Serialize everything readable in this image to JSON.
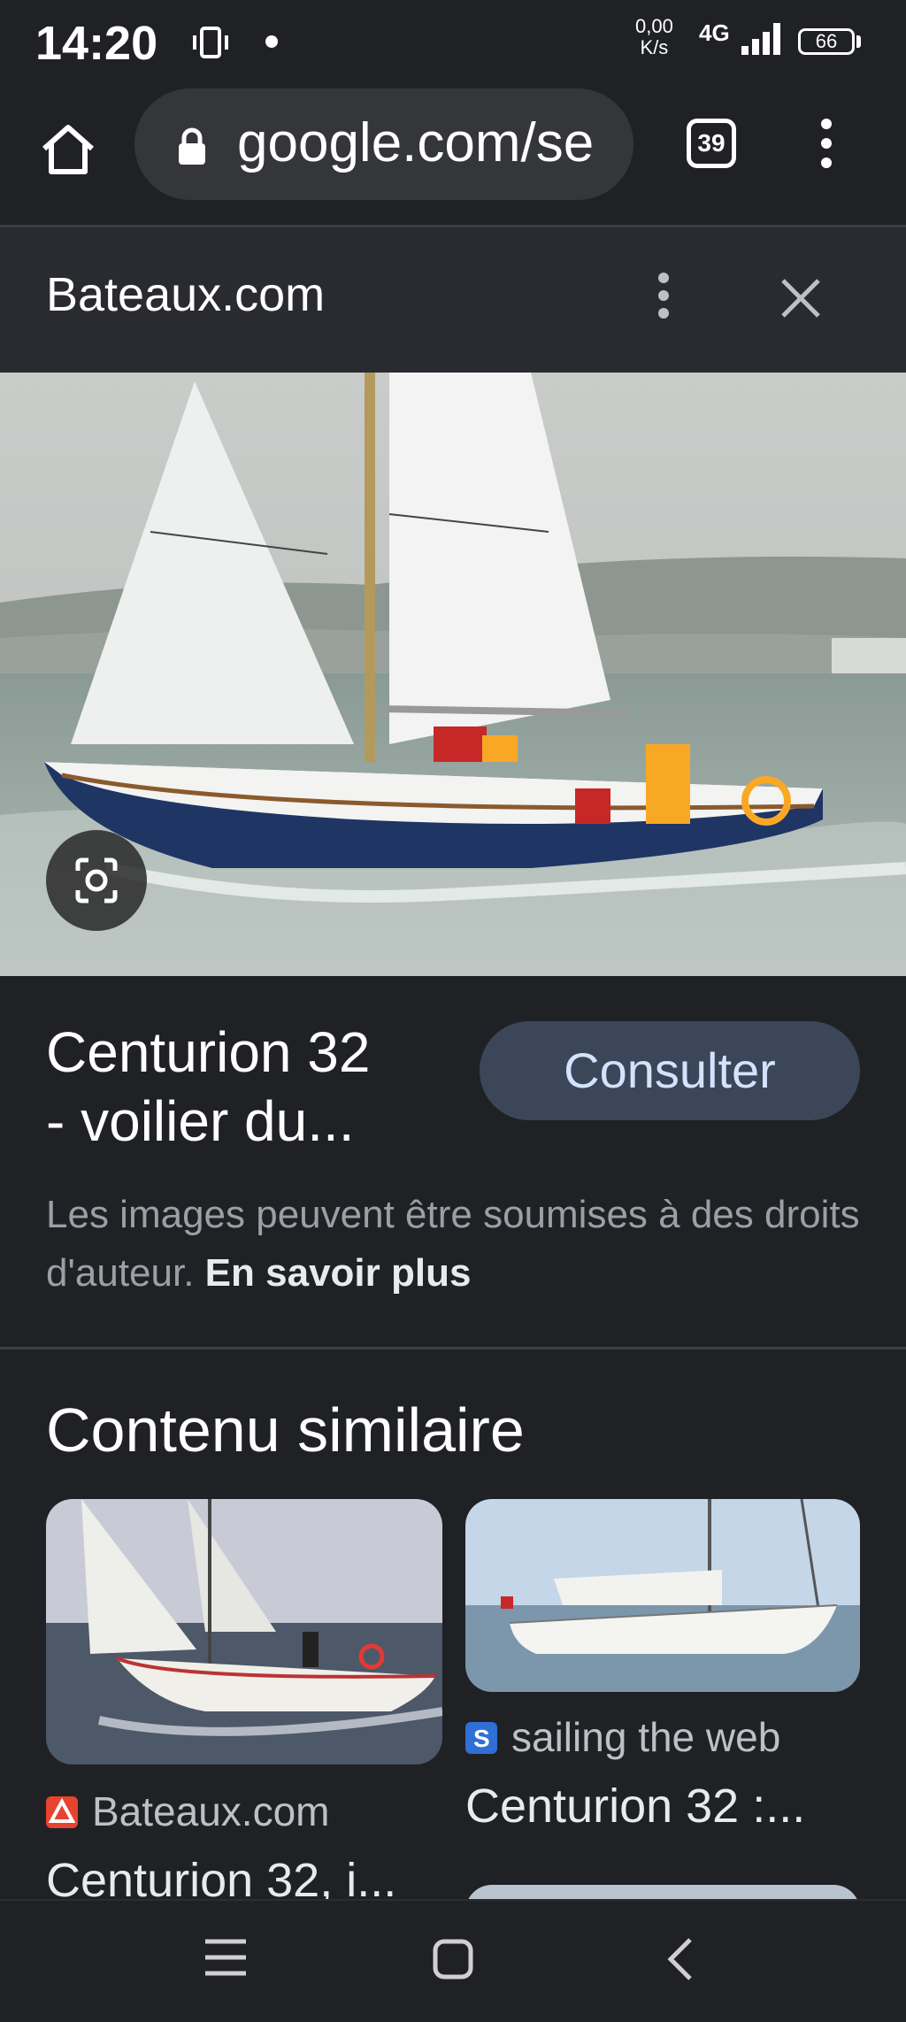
{
  "status_bar": {
    "time": "14:20",
    "speed_value": "0,00",
    "speed_unit": "K/s",
    "network": "4G",
    "battery": "66"
  },
  "browser": {
    "url": "google.com/se",
    "tab_count": "39"
  },
  "panel": {
    "source": "Bateaux.com",
    "image_title_line1": "Centurion 32",
    "image_title_line2": "- voilier du...",
    "consult_label": "Consulter",
    "copyright_text": "Les images peuvent être soumises à des droits d'auteur.",
    "learn_more": "En savoir plus"
  },
  "similar": {
    "heading": "Contenu similaire",
    "items": [
      {
        "source": "Bateaux.com",
        "title": "Centurion 32, i...",
        "icon_color": "#e8432e"
      },
      {
        "source": "sailing the web",
        "title": "Centurion 32 :...",
        "icon_color": "#2f6fd6"
      }
    ]
  },
  "colors": {
    "background": "#202124",
    "button": "#3b4659",
    "button_text": "#d3e3fd"
  }
}
